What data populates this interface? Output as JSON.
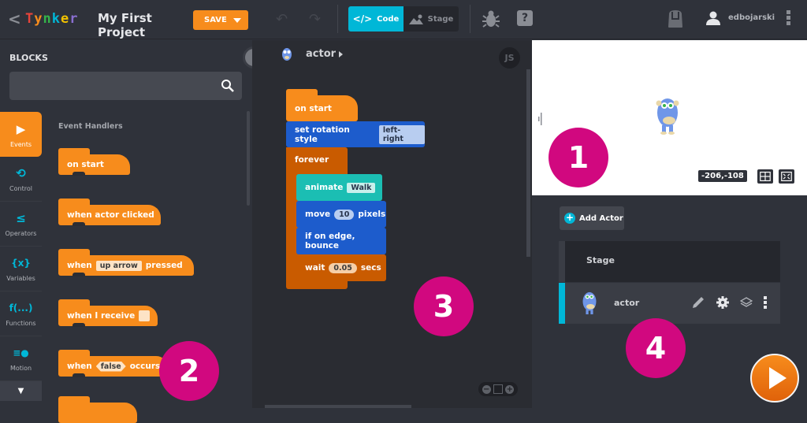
{
  "topbar": {
    "logo_letters": [
      {
        "ch": "T",
        "color": "#e8443a"
      },
      {
        "ch": "y",
        "color": "#f78c1c"
      },
      {
        "ch": "n",
        "color": "#35b34a"
      },
      {
        "ch": "k",
        "color": "#00b7d7"
      },
      {
        "ch": "e",
        "color": "#f2c200"
      },
      {
        "ch": "r",
        "color": "#8a6fd1"
      }
    ],
    "project_title": "My First Project",
    "save_label": "SAVE",
    "view_tabs": [
      {
        "label": "Code",
        "icon": "code-icon",
        "active": true
      },
      {
        "label": "Stage",
        "icon": "image-icon",
        "active": false
      }
    ],
    "username": "edbojarski"
  },
  "palette": {
    "title": "BLOCKS",
    "search": {
      "value": "",
      "placeholder": ""
    },
    "categories": [
      {
        "label": "Events",
        "icon": "▶",
        "active": true
      },
      {
        "label": "Control",
        "icon": "⟲",
        "active": false
      },
      {
        "label": "Operators",
        "icon": "≤",
        "active": false
      },
      {
        "label": "Variables",
        "icon": "{x}",
        "active": false
      },
      {
        "label": "Functions",
        "icon": "f(...)",
        "active": false
      },
      {
        "label": "Motion",
        "icon": "≡●",
        "active": false
      }
    ],
    "section_title": "Event Handlers",
    "blocks": [
      {
        "parts": [
          "on start"
        ]
      },
      {
        "parts": [
          "when actor clicked"
        ]
      },
      {
        "text_before": "when",
        "slot": "up arrow",
        "text_after": "pressed"
      },
      {
        "text_before": "when I receive",
        "slot": ""
      },
      {
        "text_before": "when",
        "slot": "false",
        "text_after": "occurs"
      }
    ]
  },
  "code": {
    "actor_name": "actor",
    "js_label": "JS",
    "script": {
      "hat": "on start",
      "set_rotation": {
        "label": "set rotation style",
        "value": "left-right"
      },
      "forever": "forever",
      "animate": {
        "label": "animate",
        "value": "Walk"
      },
      "move": {
        "before": "move",
        "value": "10",
        "after": "pixels"
      },
      "bounce": "if on edge, bounce",
      "wait": {
        "before": "wait",
        "value": "0.05",
        "after": "secs"
      }
    }
  },
  "stage": {
    "coords": "-206,-108"
  },
  "actors_panel": {
    "add_actor_label": "Add Actor",
    "stage_label": "Stage",
    "actors": [
      {
        "name": "actor",
        "selected": true
      }
    ]
  },
  "annotations": [
    "1",
    "2",
    "3",
    "4"
  ],
  "colors": {
    "accent": "#00b7d7",
    "events": "#f78c1c",
    "motion": "#1d5ccc",
    "looks": "#1bbeb3",
    "control": "#c95b00",
    "annotation": "#d1087f"
  }
}
